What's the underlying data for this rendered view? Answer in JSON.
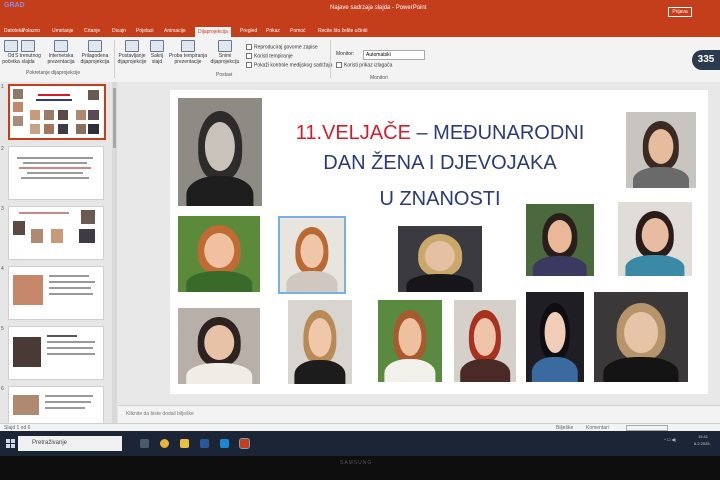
{
  "app": {
    "window_title": "Najave sadrzaja slajda - PowerPoint",
    "signin": "Prijava",
    "logo_text": "GRAD"
  },
  "tabs": [
    "Datoteka",
    "Polazno",
    "Umetanje",
    "Crtanje",
    "Dizajn",
    "Prijelazi",
    "Animacije",
    "Dijaprojekcija",
    "Pregled",
    "Prikaz",
    "Pomoć"
  ],
  "active_tab": "Dijaprojekcija",
  "tell_me": "Recite što želite učiniti",
  "ribbon": {
    "buttons": [
      {
        "label": "Od početka"
      },
      {
        "label": "S trenutnog slajda"
      },
      {
        "label": "Internetska prezentacija"
      },
      {
        "label": "Prilagođena dijaprojekcija"
      },
      {
        "label": "Postavljanje dijaprojekcije"
      },
      {
        "label": "Sakrij slajd"
      },
      {
        "label": "Proba tempiranja prezentacije"
      },
      {
        "label": "Snimi dijaprojekciju"
      }
    ],
    "checkboxes": [
      {
        "label": "Reproduciraj govorne zapise"
      },
      {
        "label": "Koristi tempiranje"
      },
      {
        "label": "Pokaži kontrole medijskog sadržaja"
      }
    ],
    "monitor_label": "Monitor:",
    "monitor_value": "Automatski",
    "presenter_view": "Koristi prikaz izlagača",
    "groups": [
      "Pokretanje dijaprojekcije",
      "Postavi",
      "Monitori"
    ]
  },
  "badge_count": "335",
  "slide": {
    "title_red": "11.VELJAČE",
    "title_rest": " – MEĐUNARODNI",
    "line2": "DAN ŽENA I DJEVOJAKA",
    "line3": "U   ZNANOSTI"
  },
  "notes_placeholder": "Kliknite da biste dodali bilješke",
  "statusbar": {
    "left": "Slajd 1 od 6",
    "notes_btn": "Bilješke",
    "comments_btn": "Komentari"
  },
  "taskbar": {
    "search_placeholder": "Pretraživanje",
    "time": "15:41",
    "date": "6.2.2025."
  },
  "monitor_brand": "SAMSUNG",
  "colors": {
    "accent": "#c43e1c",
    "title_red": "#d81b28",
    "title_blue": "#2b3a78"
  }
}
